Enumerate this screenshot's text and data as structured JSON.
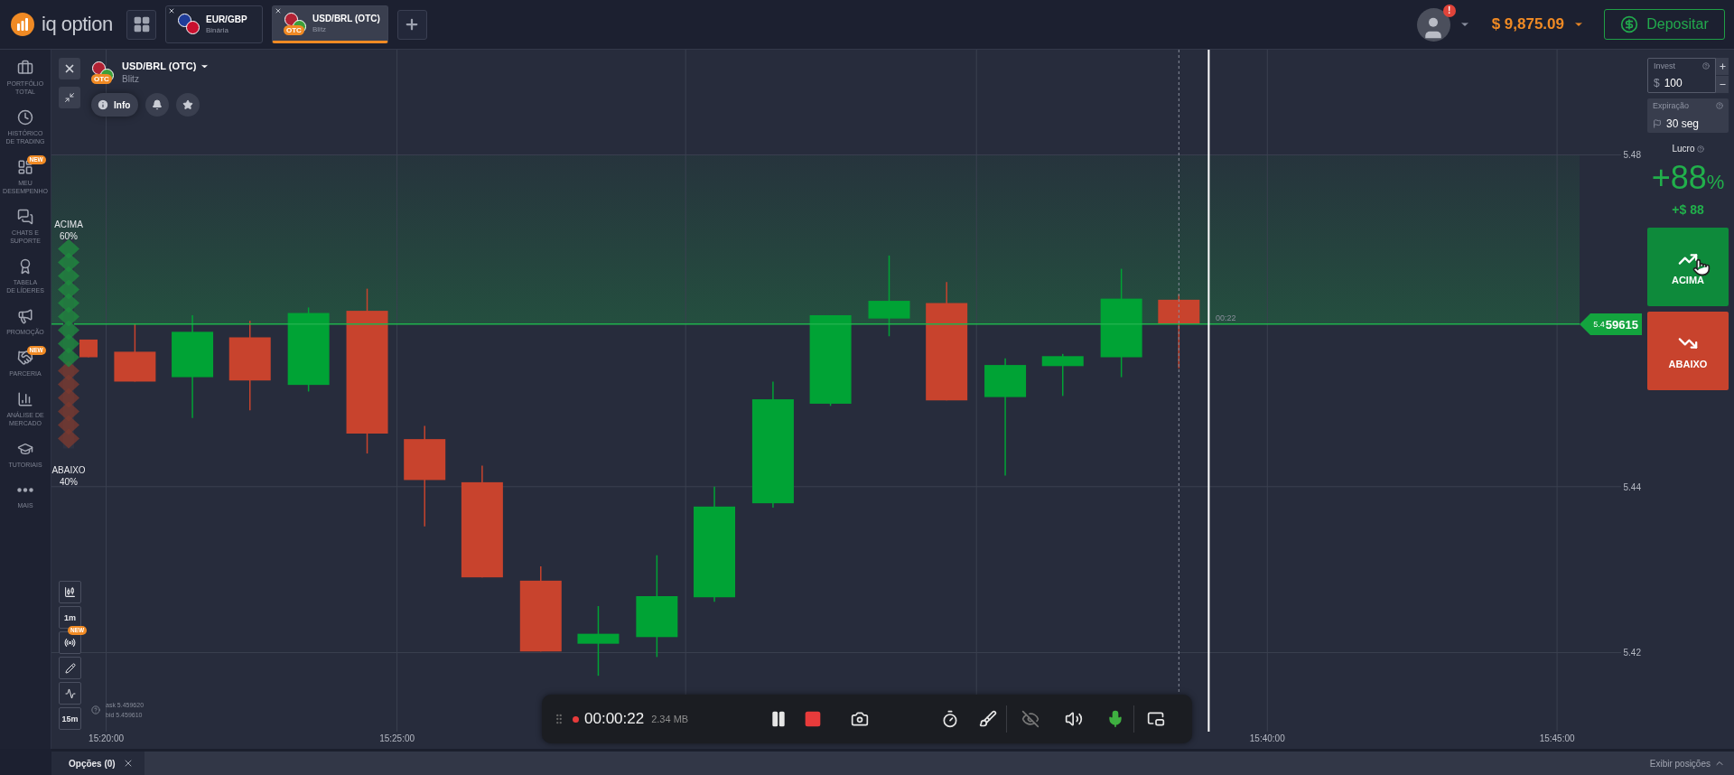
{
  "logo": {
    "name": "iq option"
  },
  "asset_tabs": [
    {
      "title": "EUR/GBP",
      "type": "Binária",
      "selected": false
    },
    {
      "title": "USD/BRL (OTC)",
      "type": "Blitz",
      "badge": "OTC",
      "selected": true
    }
  ],
  "account": {
    "alert_badge": "!",
    "balance": "$ 9,875.09"
  },
  "deposit_button": "Depositar",
  "sidebar": {
    "items": [
      {
        "label": "PORTFÓLIO\nTOTAL"
      },
      {
        "label": "HISTÓRICO\nDE TRADING"
      },
      {
        "label": "MEU\nDESEMPENHO",
        "badge": "NEW"
      },
      {
        "label": "CHATS E\nSUPORTE"
      },
      {
        "label": "TABELA\nDE LÍDERES"
      },
      {
        "label": "PROMOÇÃO"
      },
      {
        "label": "PARCERIA",
        "badge": "NEW"
      },
      {
        "label": "ANÁLISE DE\nMERCADO"
      },
      {
        "label": "TUTORIAIS"
      },
      {
        "label": "MAIS"
      }
    ]
  },
  "chart_header": {
    "asset": "USD/BRL (OTC)",
    "badge": "OTC",
    "type": "Blitz",
    "info_button": "Info"
  },
  "sentiment": {
    "up_label": "ACIMA",
    "up_percent": "60%",
    "down_label": "ABAIXO",
    "down_percent": "40%",
    "level": 0.6
  },
  "chart": {
    "y_labels": [
      "5.48",
      "5.44",
      "5.42"
    ],
    "x_labels": [
      "15:20:00",
      "15:25:00",
      "15:40:00",
      "15:45:00"
    ],
    "timer": "00:22",
    "price_prefix": "5.4",
    "price_main": "59615"
  },
  "chart_tools": {
    "timeframe": "1m",
    "new_badge": "NEW",
    "interval": "15m",
    "ask": "ask 5.459620",
    "bid": "bid 5.459610"
  },
  "trade_panel": {
    "invest_label": "Invest",
    "currency": "$",
    "invest_value": "100",
    "expiration_label": "Expiração",
    "expiration_value": "30 seg",
    "profit_label": "Lucro",
    "profit_percent": "+88",
    "percent_sign": "%",
    "profit_amount": "+$ 88",
    "up_button": "ACIMA",
    "down_button": "ABAIXO"
  },
  "recorder": {
    "recording": true,
    "time": "00:00:22",
    "size": "2.34 MB"
  },
  "bottom_bar": {
    "tab": "Opções (0)",
    "show_positions": "Exibir posições"
  }
}
